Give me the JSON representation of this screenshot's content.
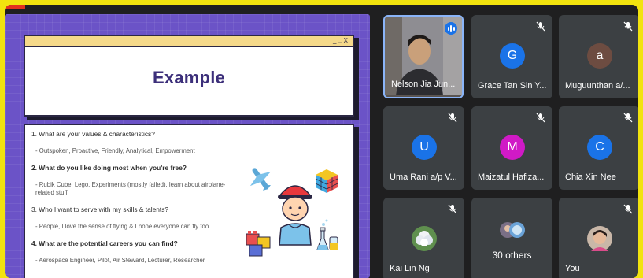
{
  "slide": {
    "heading": "Example",
    "window_controls": "_ □ X",
    "items": [
      {
        "q": "1. What are your values & characteristics?",
        "a": "- Outspoken, Proactive, Friendly, Analytical, Empowerment"
      },
      {
        "q": "2. What do you like doing most when you're free?",
        "a": "- Rubik Cube, Lego, Experiments (mostly failed), learn about airplane-related stuff"
      },
      {
        "q": "3. Who I want to serve with my skills & talents?",
        "a": "- People, I love the sense of flying & I hope everyone can fly too."
      },
      {
        "q": "4. What are the potential careers you can find?",
        "a": "- Aerospace Engineer, Pilot, Air Steward, Lecturer, Researcher"
      }
    ]
  },
  "participants": [
    {
      "name": "Nelson Jia Jun...",
      "type": "video",
      "speaking": true
    },
    {
      "name": "Grace Tan Sin Y...",
      "initial": "G",
      "color": "#1a73e8",
      "muted": true
    },
    {
      "name": "Muguunthan a/...",
      "initial": "a",
      "color": "#6d4c41",
      "muted": true
    },
    {
      "name": "Uma Rani a/p V...",
      "initial": "U",
      "color": "#1a73e8",
      "muted": true
    },
    {
      "name": "Maizatul Hafiza...",
      "initial": "M",
      "color": "#d01ac6",
      "muted": true
    },
    {
      "name": "Chia Xin Nee",
      "initial": "C",
      "color": "#1a73e8",
      "muted": true
    },
    {
      "name": "Kai Lin Ng",
      "type": "photo",
      "muted": true
    },
    {
      "name": "30 others",
      "type": "others"
    },
    {
      "name": "You",
      "type": "photo-self",
      "muted": true
    }
  ],
  "icons": {
    "muted": "mic-off-icon",
    "speaking": "audio-level-icon"
  }
}
